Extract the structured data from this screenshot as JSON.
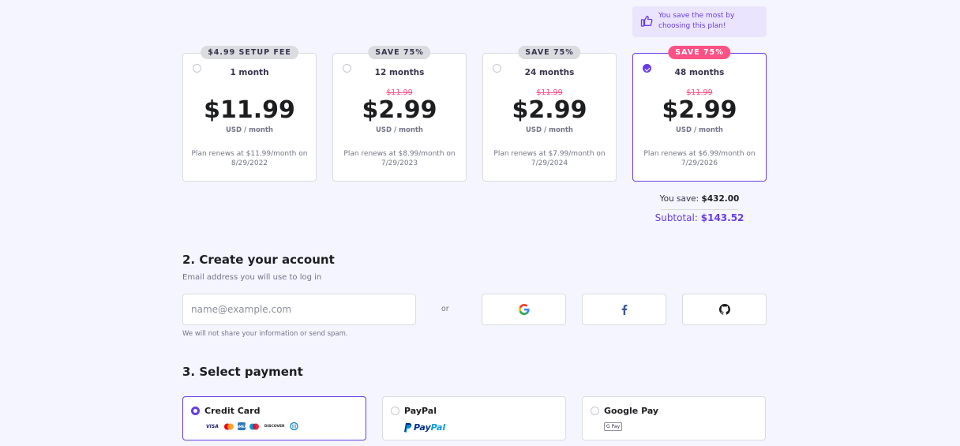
{
  "tip": {
    "text": "You save the most by choosing this plan!"
  },
  "plans": [
    {
      "badge": "$4.99 SETUP FEE",
      "duration": "1 month",
      "old_price": "",
      "price": "$11.99",
      "unit": "USD / month",
      "renew": "Plan renews at $11.99/month on 8/29/2022",
      "selected": false
    },
    {
      "badge": "SAVE 75%",
      "duration": "12 months",
      "old_price": "$11.99",
      "price": "$2.99",
      "unit": "USD / month",
      "renew": "Plan renews at $8.99/month on 7/29/2023",
      "selected": false
    },
    {
      "badge": "SAVE 75%",
      "duration": "24 months",
      "old_price": "$11.99",
      "price": "$2.99",
      "unit": "USD / month",
      "renew": "Plan renews at $7.99/month on 7/29/2024",
      "selected": false
    },
    {
      "badge": "SAVE 75%",
      "duration": "48 months",
      "old_price": "$11.99",
      "price": "$2.99",
      "unit": "USD / month",
      "renew": "Plan renews at $6.99/month on 7/29/2026",
      "selected": true
    }
  ],
  "summary": {
    "save_label": "You save:",
    "save_value": "$432.00",
    "subtotal_label": "Subtotal:",
    "subtotal_value": "$143.52"
  },
  "account": {
    "title": "2. Create your account",
    "subtitle": "Email address you will use to log in",
    "email_placeholder": "name@example.com",
    "or": "or",
    "note": "We will not share your information or send spam.",
    "social": [
      "google-icon",
      "facebook-icon",
      "github-icon"
    ]
  },
  "payment": {
    "title": "3. Select payment",
    "methods": [
      {
        "label": "Credit Card",
        "selected": true,
        "logos": [
          "VISA",
          "mastercard",
          "AMEX",
          "maestro",
          "DISCOVER",
          "diners"
        ]
      },
      {
        "label": "PayPal",
        "selected": false,
        "logo_text": [
          "Pay",
          "Pal"
        ]
      },
      {
        "label": "Google Pay",
        "selected": false,
        "logo_text": "G Pay"
      }
    ]
  },
  "colors": {
    "accent": "#673de6",
    "pink": "#fc5185",
    "background": "#f4f5ff"
  }
}
